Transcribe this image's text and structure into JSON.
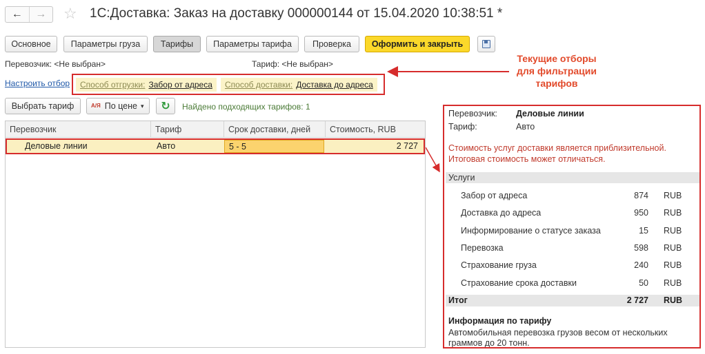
{
  "window": {
    "title": "1С:Доставка: Заказ на доставку 000000144 от 15.04.2020 10:38:51 *",
    "back_icon": "←",
    "forward_icon": "→",
    "star_icon": "☆"
  },
  "tabs": [
    {
      "label": "Основное",
      "active": false
    },
    {
      "label": "Параметры груза",
      "active": false
    },
    {
      "label": "Тарифы",
      "active": true
    },
    {
      "label": "Параметры тарифа",
      "active": false
    },
    {
      "label": "Проверка",
      "active": false
    }
  ],
  "toolbar": {
    "submit_label": "Оформить и закрыть",
    "save_icon": "floppy-disk-icon"
  },
  "info": {
    "carrier_label": "Перевозчик:",
    "carrier_value": "<Не выбран>",
    "tariff_label": "Тариф:",
    "tariff_value": "<Не выбран>"
  },
  "filters": {
    "setup_link": "Настроить отбор",
    "items": [
      {
        "key": "Способ отгрузки:",
        "value": "Забор от адреса"
      },
      {
        "key": "Способ доставки:",
        "value": "Доставка до адреса"
      }
    ]
  },
  "annotation": {
    "line1": "Текущие отборы",
    "line2": "для фильтрации",
    "line3": "тарифов"
  },
  "actions": {
    "select_tariff": "Выбрать тариф",
    "sort_label": "По цене",
    "sort_icon": "А/Я",
    "found_text": "Найдено подходящих тарифов: 1"
  },
  "table": {
    "columns": [
      "Перевозчик",
      "Тариф",
      "Срок доставки, дней",
      "Стоимость, RUB"
    ],
    "rows": [
      {
        "carrier": "Деловые линии",
        "tariff": "Авто",
        "term": "5 - 5",
        "cost": "2 727"
      }
    ]
  },
  "panel": {
    "carrier_label": "Перевозчик:",
    "carrier_value": "Деловые линии",
    "tariff_label": "Тариф:",
    "tariff_value": "Авто",
    "warning_line1": "Стоимость услуг доставки является приблизительной.",
    "warning_line2": "Итоговая стоимость может отличаться.",
    "services_header": "Услуги",
    "services": [
      {
        "name": "Забор от адреса",
        "amount": "874",
        "currency": "RUB"
      },
      {
        "name": "Доставка до адреса",
        "amount": "950",
        "currency": "RUB"
      },
      {
        "name": "Информирование о статусе заказа",
        "amount": "15",
        "currency": "RUB"
      },
      {
        "name": "Перевозка",
        "amount": "598",
        "currency": "RUB"
      },
      {
        "name": "Страхование груза",
        "amount": "240",
        "currency": "RUB"
      },
      {
        "name": "Страхование срока доставки",
        "amount": "50",
        "currency": "RUB"
      }
    ],
    "total_label": "Итог",
    "total_amount": "2 727",
    "total_currency": "RUB",
    "info_title": "Информация по тарифу",
    "info_line1": "Автомобильная перевозка грузов весом от нескольких",
    "info_line2": "граммов до 20 тонн."
  },
  "colors": {
    "highlight_red": "#d62c2c",
    "primary_yellow": "#fbd82a",
    "row_yellow": "#fbf0c1",
    "annotation_orange": "#e24a2b"
  }
}
